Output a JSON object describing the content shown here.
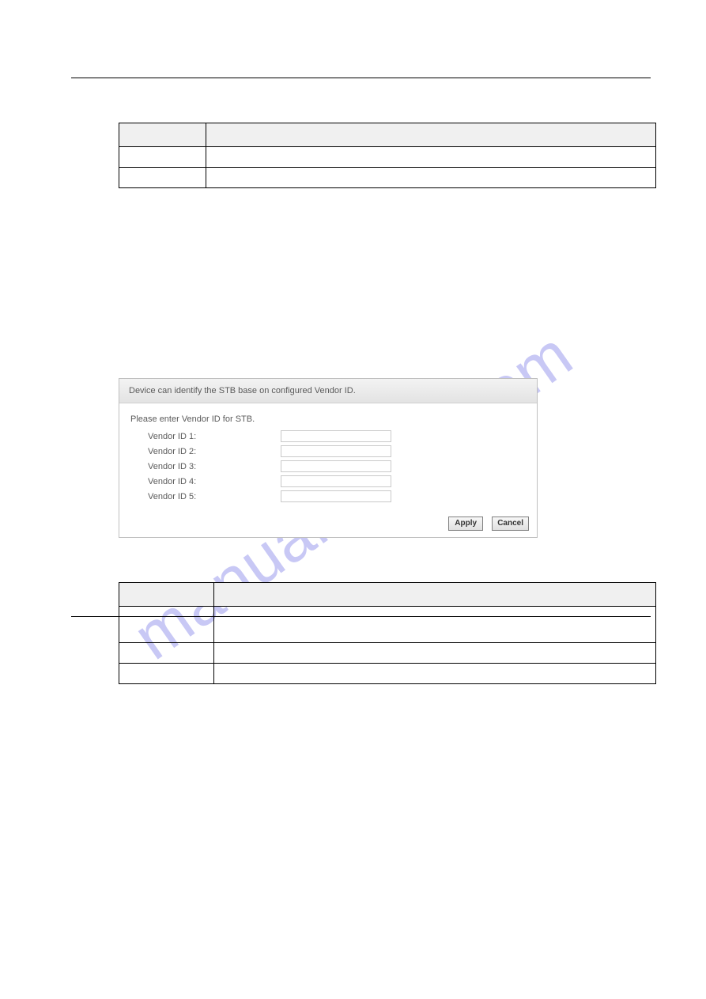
{
  "watermark": "manualshive.com",
  "panel": {
    "header": "Device can identify the STB base on configured Vendor ID.",
    "instruction": "Please enter Vendor ID for STB.",
    "fields": [
      {
        "label": "Vendor ID 1:",
        "value": ""
      },
      {
        "label": "Vendor ID 2:",
        "value": ""
      },
      {
        "label": "Vendor ID 3:",
        "value": ""
      },
      {
        "label": "Vendor ID 4:",
        "value": ""
      },
      {
        "label": "Vendor ID 5:",
        "value": ""
      }
    ],
    "apply": "Apply",
    "cancel": "Cancel"
  }
}
